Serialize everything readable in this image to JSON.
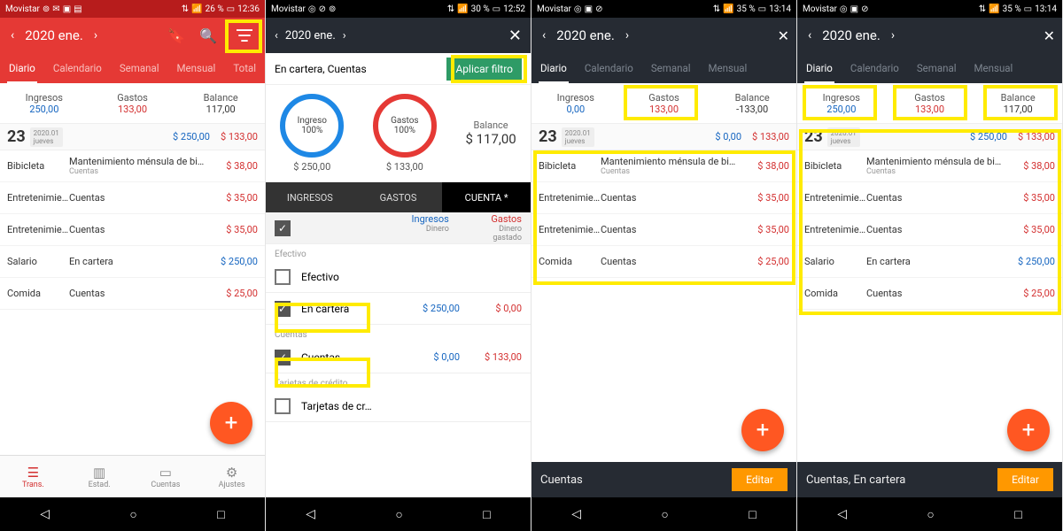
{
  "status": {
    "carrier": "Movistar",
    "p1": {
      "signal": "26 %",
      "time": "12:36",
      "icons": [
        "whatsapp",
        "mail",
        "camera",
        "photo"
      ]
    },
    "p2": {
      "signal": "30 %",
      "time": "12:52",
      "icons": [
        "instagram",
        "link",
        "whatsapp"
      ]
    },
    "p3": {
      "signal": "35 %",
      "time": "13:14",
      "icons": [
        "instagram",
        "camera",
        "link"
      ]
    },
    "p4": {
      "signal": "35 %",
      "time": "13:14",
      "icons": [
        "instagram",
        "camera",
        "link"
      ]
    },
    "net": "Ⓡ"
  },
  "header": {
    "title": "2020 ene."
  },
  "tabs": {
    "diario": "Diario",
    "calendario": "Calendario",
    "semanal": "Semanal",
    "mensual": "Mensual",
    "total": "Total"
  },
  "summary1": {
    "ing_l": "Ingresos",
    "ing_v": "250,00",
    "gas_l": "Gastos",
    "gas_v": "133,00",
    "bal_l": "Balance",
    "bal_v": "117,00"
  },
  "summary3": {
    "ing_l": "Ingresos",
    "ing_v": "0,00",
    "gas_l": "Gastos",
    "gas_v": "133,00",
    "bal_l": "Balance",
    "bal_v": "-133,00"
  },
  "summary4": {
    "ing_l": "Ingresos",
    "ing_v": "250,00",
    "gas_l": "Gastos",
    "gas_v": "133,00",
    "bal_l": "Balance",
    "bal_v": "117,00"
  },
  "date": {
    "day": "23",
    "ym": "2020.01",
    "wd": "jueves",
    "inc": "$ 250,00",
    "exp": "$ 133,00"
  },
  "date3": {
    "day": "23",
    "ym": "2020.01",
    "wd": "jueves",
    "inc": "$ 0,00",
    "exp": "$ 133,00"
  },
  "tx1": [
    {
      "cat": "Bibicleta",
      "d1": "Mantenimiento ménsula de bi…",
      "d2": "Cuentas",
      "amt": "$ 38,00",
      "cls": "red"
    },
    {
      "cat": "Entretenimie…",
      "d1": "Cuentas",
      "d2": "",
      "amt": "$ 35,00",
      "cls": "red"
    },
    {
      "cat": "Entretenimie…",
      "d1": "Cuentas",
      "d2": "",
      "amt": "$ 35,00",
      "cls": "red"
    },
    {
      "cat": "Salario",
      "d1": "En cartera",
      "d2": "",
      "amt": "$ 250,00",
      "cls": "blue"
    },
    {
      "cat": "Comida",
      "d1": "Cuentas",
      "d2": "",
      "amt": "$ 25,00",
      "cls": "red"
    }
  ],
  "tx3": [
    {
      "cat": "Bibicleta",
      "d1": "Mantenimiento ménsula de bi…",
      "d2": "Cuentas",
      "amt": "$ 38,00",
      "cls": "red"
    },
    {
      "cat": "Entretenimie…",
      "d1": "Cuentas",
      "d2": "",
      "amt": "$ 35,00",
      "cls": "red"
    },
    {
      "cat": "Entretenimie…",
      "d1": "Cuentas",
      "d2": "",
      "amt": "$ 35,00",
      "cls": "red"
    },
    {
      "cat": "Comida",
      "d1": "Cuentas",
      "d2": "",
      "amt": "$ 25,00",
      "cls": "red"
    }
  ],
  "bottomnav": {
    "trans": "Trans.",
    "estad": "Estad.",
    "cuentas": "Cuentas",
    "ajustes": "Ajustes"
  },
  "pane2": {
    "sub": "En cartera, Cuentas",
    "apply": "Aplicar filtro",
    "ingreso": "Ingreso",
    "gastos_d": "Gastos",
    "pct": "100%",
    "amt_ing": "$ 250,00",
    "amt_gas": "$ 133,00",
    "bal_l": "Balance",
    "bal_v": "$ 117,00",
    "seg": {
      "ingresos": "INGRESOS",
      "gastos": "GASTOS",
      "cuenta": "CUENTA *"
    },
    "hdr": {
      "ing": "Ingresos",
      "ing_s": "Dinero",
      "gas": "Gastos",
      "gas_s": "Dinero gastado"
    },
    "grp_efectivo": "Efectivo",
    "opt_efectivo": "Efectivo",
    "opt_cartera": "En cartera",
    "cart_a": "$ 250,00",
    "cart_b": "$ 0,00",
    "grp_cuentas": "Cuentas",
    "opt_cuentas": "Cuentas",
    "cue_a": "$ 0,00",
    "cue_b": "$ 133,00",
    "grp_tarj": "Tarjetas de crédito",
    "opt_tarj": "Tarjetas de cr…"
  },
  "editbar3": "Cuentas",
  "editbar4": "Cuentas, En cartera",
  "editbtn": "Editar"
}
